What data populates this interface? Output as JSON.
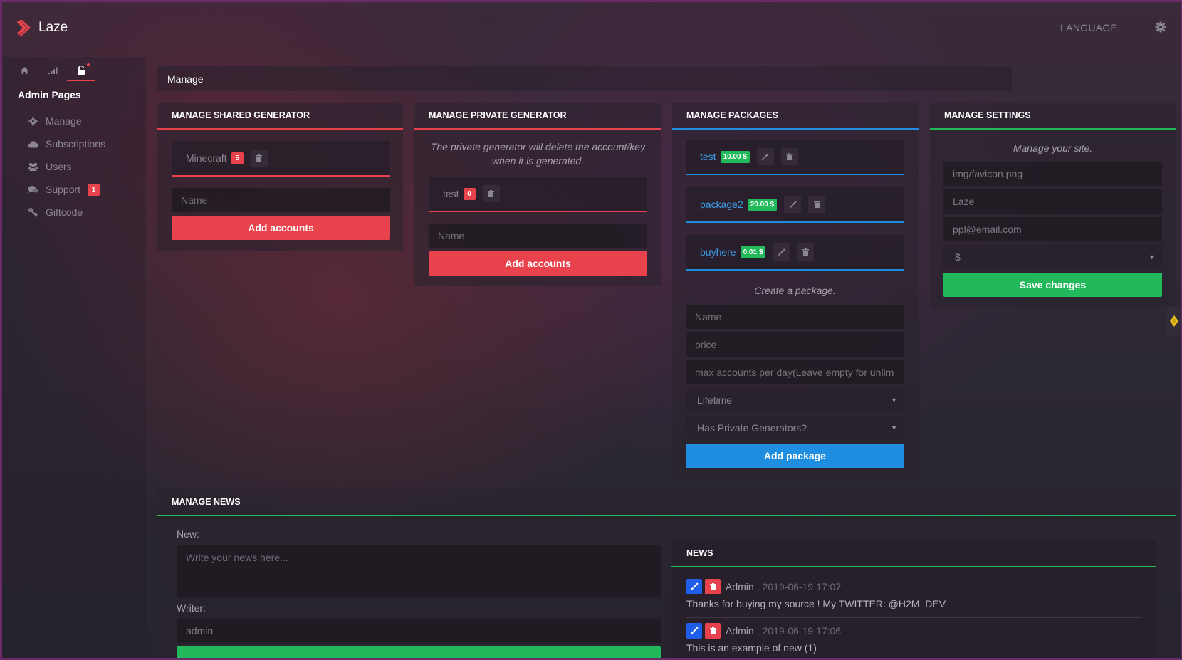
{
  "app": {
    "name": "Laze"
  },
  "header": {
    "language_label": "LANGUAGE",
    "gear_icon": "gear-icon"
  },
  "sidebar": {
    "tabs": [
      {
        "icon": "home-icon"
      },
      {
        "icon": "signal-icon"
      },
      {
        "icon": "unlock-icon",
        "active": true
      }
    ],
    "title": "Admin Pages",
    "items": [
      {
        "label": "Manage",
        "icon": "gear-icon"
      },
      {
        "label": "Subscriptions",
        "icon": "cloud-icon"
      },
      {
        "label": "Users",
        "icon": "users-icon"
      },
      {
        "label": "Support",
        "icon": "comments-icon",
        "badge": "1"
      },
      {
        "label": "Giftcode",
        "icon": "key-icon"
      }
    ]
  },
  "page": {
    "title": "Manage"
  },
  "shared_generator": {
    "title": "MANAGE SHARED GENERATOR",
    "items": [
      {
        "name": "Minecraft",
        "count": "5"
      }
    ],
    "name_placeholder": "Name",
    "add_button": "Add accounts"
  },
  "private_generator": {
    "title": "MANAGE PRIVATE GENERATOR",
    "note": "The private generator will delete the account/key when it is generated.",
    "items": [
      {
        "name": "test",
        "count": "0"
      }
    ],
    "name_placeholder": "Name",
    "add_button": "Add accounts"
  },
  "packages": {
    "title": "MANAGE PACKAGES",
    "items": [
      {
        "name": "test",
        "price": "10.00 $"
      },
      {
        "name": "package2",
        "price": "20.00 $"
      },
      {
        "name": "buyhere",
        "price": "0.01 $"
      }
    ],
    "create_note": "Create a package.",
    "name_placeholder": "Name",
    "price_placeholder": "price",
    "max_placeholder": "max accounts per day(Leave empty for unlim",
    "duration_select": "Lifetime",
    "private_select": "Has Private Generators?",
    "add_button": "Add package"
  },
  "settings": {
    "title": "MANAGE SETTINGS",
    "note": "Manage your site.",
    "favicon_value": "img/favicon.png",
    "site_name_value": "Laze",
    "email_value": "ppl@email.com",
    "currency_select": "$",
    "save_button": "Save changes"
  },
  "news_manage": {
    "title": "MANAGE NEWS",
    "new_label": "New:",
    "textarea_placeholder": "Write your news here...",
    "writer_label": "Writer:",
    "writer_value": "admin"
  },
  "news": {
    "title": "NEWS",
    "items": [
      {
        "author": "Admin",
        "date": "2019-06-19 17:07",
        "text": "Thanks for buying my source ! My TWITTER: @H2M_DEV"
      },
      {
        "author": "Admin",
        "date": "2019-06-19 17:06",
        "text": "This is an example of new (1)"
      }
    ]
  },
  "colors": {
    "red": "#e8424c",
    "blue": "#1f8ee0",
    "green": "#22b95a"
  }
}
